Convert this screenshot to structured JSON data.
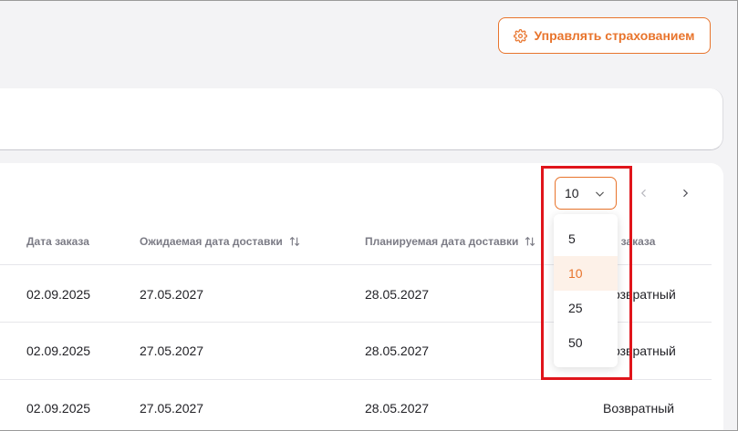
{
  "header": {
    "manage_button_label": "Управлять страхованием"
  },
  "pagination": {
    "page_size": "10",
    "options": [
      "5",
      "10",
      "25",
      "50"
    ],
    "selected_option": "10"
  },
  "table": {
    "columns": {
      "order_date": "Дата заказа",
      "expected_delivery": "Ожидаемая дата доставки",
      "planned_delivery": "Планируемая дата доставки",
      "order_type_partial": "п заказа"
    },
    "rows": [
      {
        "order_date": "02.09.2025",
        "expected_delivery": "27.05.2027",
        "planned_delivery": "28.05.2027",
        "type": "озвратный"
      },
      {
        "order_date": "02.09.2025",
        "expected_delivery": "27.05.2027",
        "planned_delivery": "28.05.2027",
        "type": "озвратный"
      },
      {
        "order_date": "02.09.2025",
        "expected_delivery": "27.05.2027",
        "planned_delivery": "28.05.2027",
        "type": "Возвратный"
      }
    ]
  },
  "colors": {
    "accent": "#e8742c",
    "highlight": "#e0151b"
  }
}
